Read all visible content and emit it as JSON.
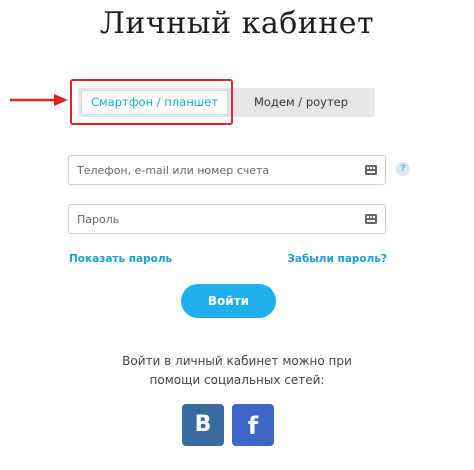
{
  "page": {
    "title": "Личный кабинет"
  },
  "tabs": [
    {
      "label": "Смартфон / планшет",
      "active": true
    },
    {
      "label": "Модем / роутер",
      "active": false
    }
  ],
  "login_field": {
    "placeholder": "Телефон, e-mail или номер счета",
    "value": ""
  },
  "password_field": {
    "placeholder": "Пароль",
    "value": ""
  },
  "help_icon": {
    "glyph": "?"
  },
  "links": {
    "show_password": "Показать пароль",
    "forgot_password": "Забыли пароль?"
  },
  "login_button": {
    "label": "Войти"
  },
  "social": {
    "text": "Войти в личный кабинет можно при помощи социальных сетей:",
    "vk_label": "B",
    "fb_label": "f"
  },
  "colors": {
    "accent": "#1fb0ec",
    "link": "#1a9fd6",
    "highlight": "#d9262a",
    "vk": "#3a6a9f",
    "facebook": "#3b66c4"
  },
  "icons": [
    "arrow-icon",
    "keyboard-icon",
    "help-icon",
    "vk-icon",
    "facebook-icon"
  ]
}
